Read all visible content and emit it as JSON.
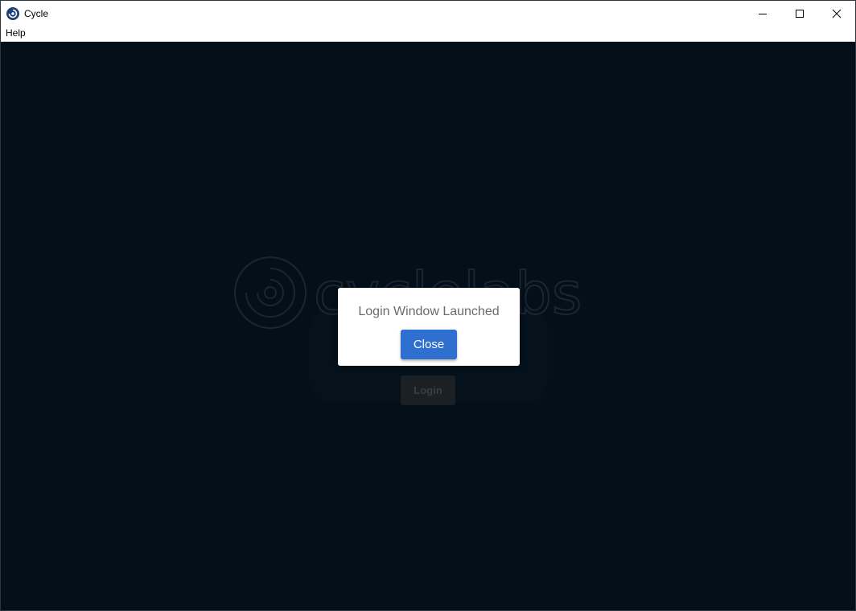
{
  "window": {
    "title": "Cycle",
    "icon": "cycle-app-icon",
    "controls": [
      "minimize-icon",
      "maximize-icon",
      "close-icon"
    ]
  },
  "menubar": {
    "items": [
      {
        "label": "Help"
      }
    ]
  },
  "background": {
    "logo_text": "cyclelabs",
    "login_button_label": "Login"
  },
  "dialog": {
    "message": "Login Window Launched",
    "close_label": "Close"
  },
  "colors": {
    "background": "#030f19",
    "accent": "#2f6fcf",
    "dialog_bg": "#ffffff",
    "message_text": "#6b6b6b"
  }
}
